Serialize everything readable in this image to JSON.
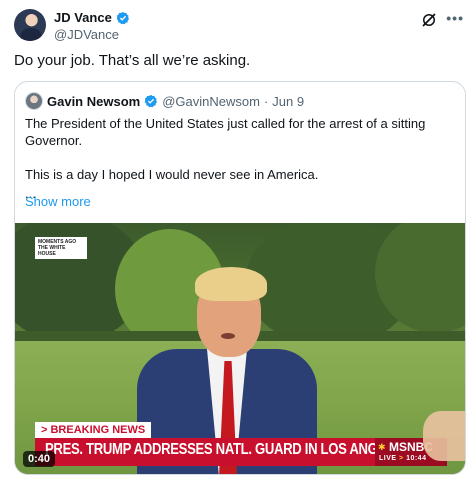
{
  "post": {
    "author_name": "JD Vance",
    "author_handle": "@JDVance",
    "text": "Do your job. That’s all we’re asking."
  },
  "quoted": {
    "author_name": "Gavin Newsom",
    "author_handle": "@GavinNewsom",
    "separator": "·",
    "date": "Jun 9",
    "line1": "The President of the United States just called for the arrest of a sitting Governor.",
    "line2": "This is a day I hoped I would never see in America.",
    "ellipsis": "...",
    "show_more": "Show more"
  },
  "video": {
    "overlay_label": "MOMENTS AGO THE WHITE HOUSE",
    "breaking": "> BREAKING NEWS",
    "headline": "PRES. TRUMP ADDRESSES NATL. GUARD IN LOS ANGELES",
    "network": "MSNBC",
    "live": "LIVE",
    "live_arrow": ">",
    "time": "10:44",
    "duration": "0:40"
  },
  "icons": [
    "verified-badge-icon",
    "grok-icon",
    "more-icon",
    "peacock-logo-icon"
  ],
  "colors": {
    "link": "#1d9bf0",
    "verified": "#1d9bf0",
    "msnbc_red": "#c8102e",
    "secondary_text": "#536471"
  }
}
